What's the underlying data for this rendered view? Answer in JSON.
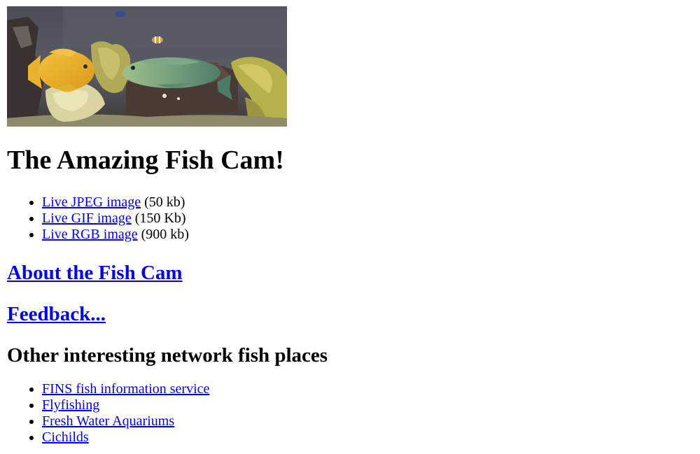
{
  "header": {
    "title": "The Amazing Fish Cam!"
  },
  "camera_links": [
    {
      "label": "Live JPEG image",
      "size": " (50 kb)"
    },
    {
      "label": "Live GIF image",
      "size": " (150 Kb)"
    },
    {
      "label": "Live RGB image",
      "size": " (900 kb)"
    }
  ],
  "about_link": "About the Fish Cam",
  "feedback_link": "Feedback...",
  "other_heading": "Other interesting network fish places",
  "other_links": [
    "FINS fish information service",
    "Flyfishing",
    "Fresh Water Aquariums",
    "Cichilds"
  ],
  "colors": {
    "link": "#0000ee",
    "text": "#000000",
    "background": "#ffffff"
  }
}
